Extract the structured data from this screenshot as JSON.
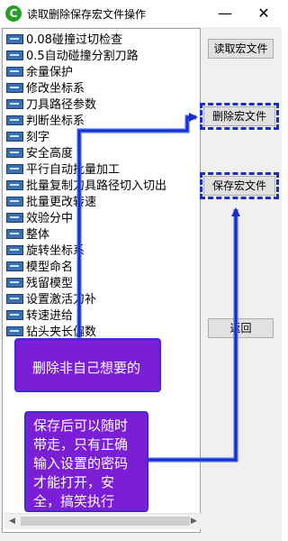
{
  "window": {
    "title": "读取删除保存宏文件操作",
    "app_icon_letter": "C",
    "minimize_glyph": "—",
    "close_glyph": "✕"
  },
  "macro_list": {
    "items": [
      "0.08碰撞过切检查",
      "0.5自动碰撞分割刀路",
      "余量保护",
      "修改坐标系",
      "刀具路径参数",
      "判断坐标系",
      "刻字",
      "安全高度",
      "平行自动批量加工",
      "批量复制刀具路径切入切出",
      "批量更改转速",
      "效验分中",
      "整体",
      "旋转坐标系",
      "模型命名",
      "残留模型",
      "设置激活刀补",
      "转速进给",
      "钻头夹长偏数"
    ],
    "scroll_left_glyph": "◀",
    "scroll_right_glyph": "▶"
  },
  "buttons": {
    "read": "读取宏文件",
    "delete": "删除宏文件",
    "save": "保存宏文件",
    "back": "返回"
  },
  "annotations": {
    "delete_note": "删除非自己想要的",
    "save_note": "保存后可以随时带走，只有正确输入设置的密码才能打开，安全，搞笑执行"
  },
  "colors": {
    "callout_fill": "#7a1fd6",
    "arrow_blue": "#1c2cc8"
  }
}
